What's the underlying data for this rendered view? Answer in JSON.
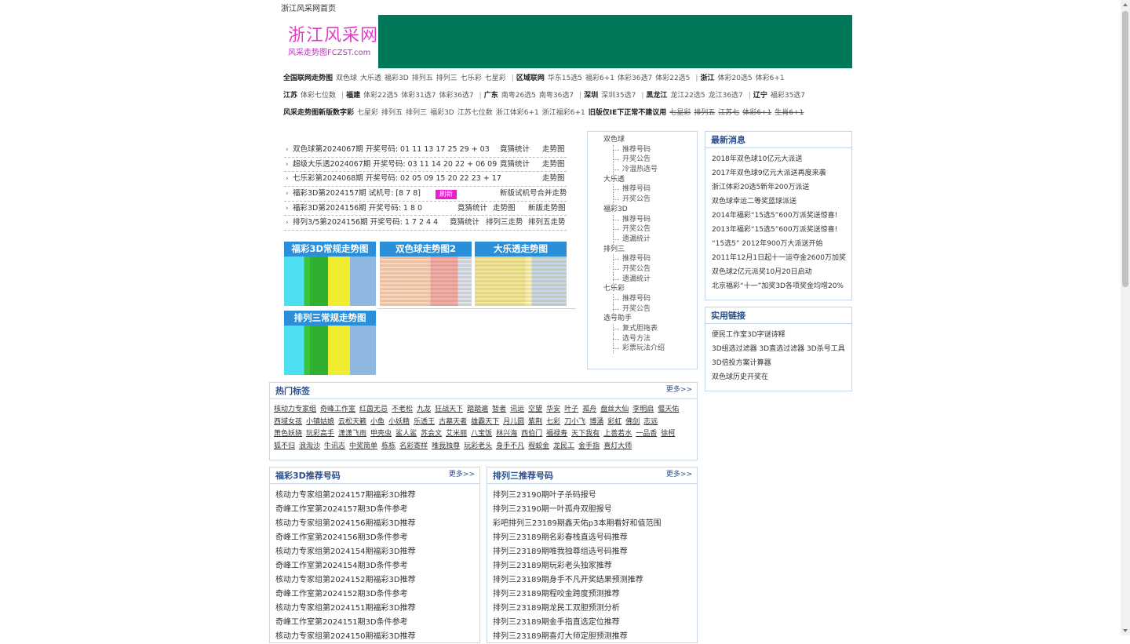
{
  "top_link": "浙江风采网首页",
  "logo": {
    "main": "浙江风采网",
    "sub": "风采走势图FCZST.com"
  },
  "nav": {
    "row1": [
      "全国联网走势图",
      "双色球",
      "大乐透",
      "福彩3D",
      "排列五",
      "排列三",
      "七乐彩",
      "七星彩",
      "|",
      "区域联网",
      "华东15选5",
      "福彩6+1",
      "体彩36选7",
      "体彩22选5",
      "|",
      "浙江",
      "体彩20选5",
      "体彩6+1"
    ],
    "row2": [
      "江苏",
      "体彩七位数",
      "|",
      "福建",
      "体彩22选5",
      "体彩31选7",
      "体彩36选7",
      "|",
      "广东",
      "南粤26选5",
      "南粤36选7",
      "|",
      "深圳",
      "深圳35选7",
      "|",
      "黑龙江",
      "龙江22选5",
      "龙江36选7",
      "|",
      "辽宁",
      "福彩35选7"
    ],
    "row3": [
      "风采走势图新版数字彩",
      "七星彩",
      "排列五",
      "排列三",
      "福彩3D",
      "江苏七位数",
      "浙江体彩6+1",
      "浙江福彩6+1",
      "旧版仅IE下正常不建议用",
      "七星彩",
      "排列五",
      "江苏七",
      "体彩6+1",
      "生肖6+1"
    ]
  },
  "results": [
    {
      "title": "双色球第2024067期",
      "label": "开奖号码:",
      "nums": "01 11 13 17 25 29 + 03",
      "l1": "竟猜统计",
      "l2": "走势图"
    },
    {
      "title": "超级大乐透2024067期",
      "label": "开奖号码:",
      "nums": "03 11 14 20 22 + 06 09",
      "l1": "竟猜统计",
      "l2": "走势图"
    },
    {
      "title": "七乐彩第2024068期",
      "label": "开奖号码:",
      "nums": "02 05 09 15 20 22 23 + 17",
      "l1": "",
      "l2": "走势图"
    },
    {
      "title": "福彩3D第2024157期",
      "label": "试机号:",
      "nums": "[8 7 8]",
      "refresh": "刷新",
      "l1": "新版试机号合并走势",
      "l2": ""
    },
    {
      "title": "福彩3D第2024156期",
      "label": "开奖号码:",
      "nums": "1 8 0",
      "l1": "竟猜统计",
      "l2": "走势图",
      "l3": "新版走势图"
    },
    {
      "title": "排列3/5第2024156期",
      "label": "开奖号码:",
      "nums": "1 7 2 4 4",
      "l1": "竟猜统计",
      "l2": "排列三走势",
      "l3": "排列五走势"
    }
  ],
  "thumbs": [
    "福彩3D常规走势图",
    "双色球走势图2",
    "大乐透走势图",
    "排列三常规走势图"
  ],
  "tree": [
    {
      "group": "双色球",
      "items": [
        "推荐号码",
        "开奖公告",
        "冷温热选号"
      ]
    },
    {
      "group": "大乐透",
      "items": [
        "推荐号码",
        "开奖公告"
      ]
    },
    {
      "group": "福彩3D",
      "items": [
        "推荐号码",
        "开奖公告",
        "遗漏统计"
      ]
    },
    {
      "group": "排列三",
      "items": [
        "推荐号码",
        "开奖公告",
        "遗漏统计"
      ]
    },
    {
      "group": "七乐彩",
      "items": [
        "推荐号码",
        "开奖公告"
      ]
    },
    {
      "group": "选号助手",
      "items": [
        "复式胆拖表",
        "选号方法",
        "彩票玩法介绍"
      ]
    }
  ],
  "news": {
    "title": "最新消息",
    "items": [
      "2018年双色球10亿元大派送",
      "2017年双色球9亿元大派送再度来袭",
      "浙江体彩20选5新年200万派送",
      "双色球幸运二等奖蓝球派送",
      "2014年福彩“15选5”600万派奖送惊喜!",
      "2013年福彩“15选5”600万派奖送惊喜!",
      "“15选5” 2012年900万大派送开始",
      "2011年12月1日起十一运夺金2600万加奖",
      "双色球2亿元派奖10月20日启动",
      "北京福彩“十一”加奖3D各项奖金均增20%"
    ]
  },
  "links": {
    "title": "实用链接",
    "items": [
      "便民工作室3D字谜诗释",
      "3D组选过滤器 3D直选过滤器 3D杀号工具",
      "3D倍投方案计算器",
      "双色球历史开奖在"
    ]
  },
  "tags": {
    "title": "热门标签",
    "more": "更多>>",
    "rows": [
      [
        "核动力专家组",
        "奇峰工作室",
        "红茵无忌",
        "不老松",
        "九龙",
        "狂战天下",
        "踏踏遍",
        "智者",
        "讯运",
        "空望",
        "华安",
        "叶子",
        "孤舟",
        "盘丝大仙",
        "李明启",
        "偃天佑"
      ],
      [
        "西域女孩",
        "小镇姑娘",
        "云松天籁",
        "小鱼",
        "小妖精",
        "乐透王",
        "古墓天者",
        "雄霸天下",
        "月儿圆",
        "紫荆",
        "七彩",
        "刀小飞",
        "博涌",
        "彩虹",
        "佛剑",
        "志远"
      ],
      [
        "萧色妖娆",
        "玩彩高手",
        "潇潇飞雨",
        "甲壳虫",
        "鲨人鲨",
        "苏会文",
        "艾米丽",
        "八宝饭",
        "林兴海",
        "西伯门",
        "福禄寿",
        "天下我有",
        "上善若水",
        "一品香",
        "徐柯"
      ],
      [
        "狐不归",
        "浪淘沙",
        "牛讯志",
        "中奖简单",
        "栋栋",
        "名彩寄样",
        "唯我独尊",
        "玩彩老头",
        "身手不凡",
        "程蛟金",
        "龙民工",
        "金手指",
        "喜灯大师"
      ]
    ]
  },
  "rec3d": {
    "title": "福彩3D推荐号码",
    "more": "更多>>",
    "items": [
      "核动力专家组第2024157期福彩3D推荐",
      "奇峰工作室第2024157期3D条件参考",
      "核动力专家组第2024156期福彩3D推荐",
      "奇峰工作室第2024156期3D条件参考",
      "核动力专家组第2024154期福彩3D推荐",
      "奇峰工作室第2024154期3D条件参考",
      "核动力专家组第2024152期福彩3D推荐",
      "奇峰工作室第2024152期3D条件参考",
      "核动力专家组第2024151期福彩3D推荐",
      "奇峰工作室第2024151期3D条件参考",
      "核动力专家组第2024150期福彩3D推荐"
    ]
  },
  "recpl3": {
    "title": "排列三推荐号码",
    "more": "更多>>",
    "items": [
      "排列三23190期叶子杀码报号",
      "排列三23190期一叶孤舟双胆报号",
      "彩吧排列三23189期鑫天佑p3本期看好和值范围",
      "排列三23189期名彩春栈直选号码推荐",
      "排列三23189期唯我独尊组选号码推荐",
      "排列三23189期玩彩老头独家推荐",
      "排列三23189期身手不凡开奖结果预测推荐",
      "排列三23189期程咬金跨度预测推荐",
      "排列三23189期龙民工双胆预测分析",
      "排列三23189期金手指直选定位推荐",
      "排列三23189期喜灯大师定胆预测推荐"
    ]
  }
}
